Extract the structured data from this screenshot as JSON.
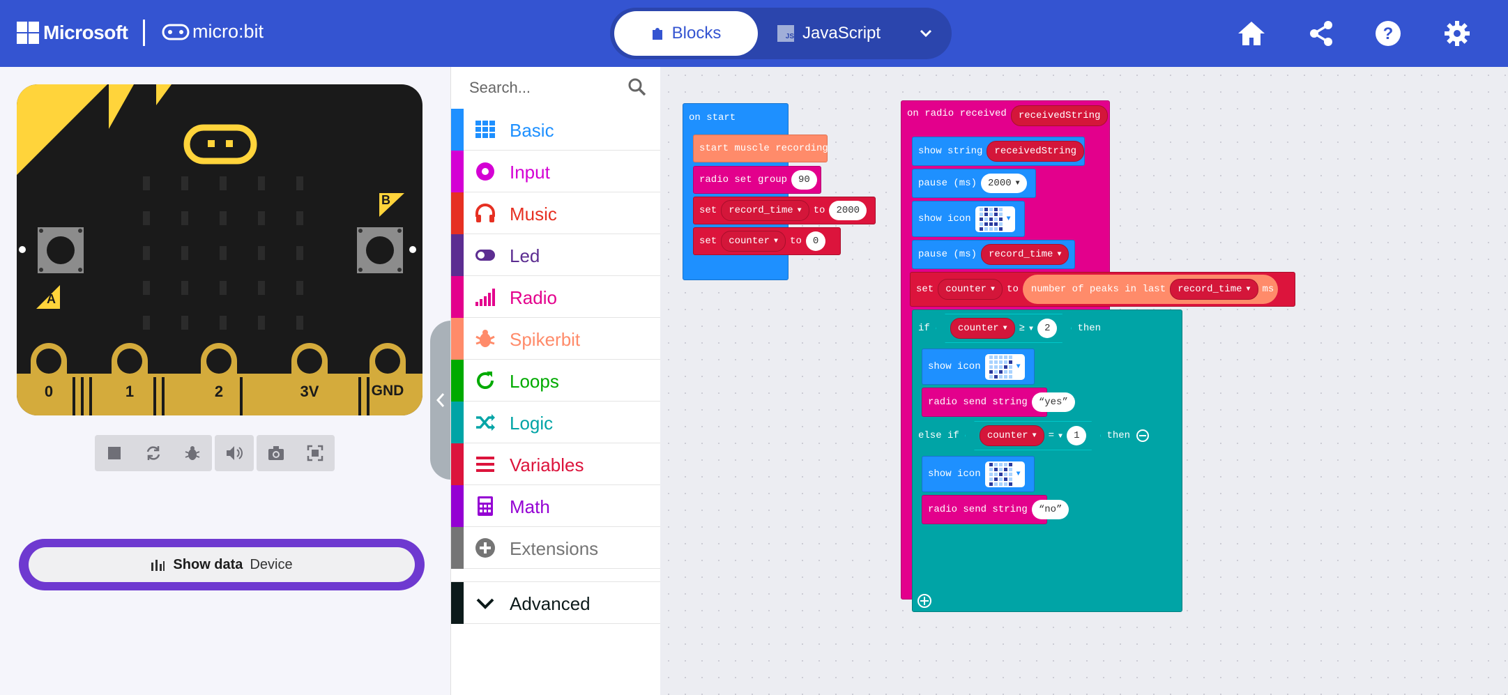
{
  "header": {
    "microsoft_label": "Microsoft",
    "microbit_label": "micro:bit",
    "tabs": [
      {
        "label": "Blocks",
        "active": true
      },
      {
        "label": "JavaScript",
        "active": false
      }
    ],
    "js_badge": "JS",
    "icons": [
      "home-icon",
      "share-icon",
      "help-icon",
      "settings-icon"
    ],
    "color": "#3454d1"
  },
  "simulator": {
    "pin_labels": [
      "0",
      "1",
      "2",
      "3V",
      "GND"
    ],
    "button_a": "A",
    "button_b": "B",
    "toolbar_icons": [
      "stop-icon",
      "restart-icon",
      "debug-icon",
      "mute-icon",
      "screenshot-icon",
      "fullscreen-icon"
    ],
    "show_data": {
      "label": "Show data",
      "sublabel": "Device"
    }
  },
  "toolbox": {
    "search_placeholder": "Search...",
    "categories": [
      {
        "label": "Basic",
        "color": "#1e90ff",
        "icon": "grid-icon"
      },
      {
        "label": "Input",
        "color": "#d400d4",
        "icon": "circle-dot-icon"
      },
      {
        "label": "Music",
        "color": "#e63022",
        "icon": "headphones-icon"
      },
      {
        "label": "Led",
        "color": "#5c2d91",
        "icon": "toggle-icon"
      },
      {
        "label": "Radio",
        "color": "#e3008c",
        "icon": "signal-bars-icon"
      },
      {
        "label": "Spikerbit",
        "color": "#ff8b6a",
        "icon": "bug-icon"
      },
      {
        "label": "Loops",
        "color": "#00aa00",
        "icon": "loop-arrow-icon"
      },
      {
        "label": "Logic",
        "color": "#00a4a6",
        "icon": "shuffle-icon"
      },
      {
        "label": "Variables",
        "color": "#dc143c",
        "icon": "list-lines-icon"
      },
      {
        "label": "Math",
        "color": "#9400d3",
        "icon": "calculator-icon"
      },
      {
        "label": "Extensions",
        "color": "#757575",
        "icon": "plus-circle-icon"
      }
    ],
    "advanced": {
      "label": "Advanced",
      "color": "#0c1a1a",
      "icon": "chevron-down-icon"
    }
  },
  "blocks": {
    "on_start": {
      "hat": "on start",
      "start_recording": "start muscle recording",
      "radio_set_group": "radio set group",
      "group_value": "90",
      "set1_kw": "set",
      "set1_var": "record_time",
      "set1_to": "to",
      "set1_value": "2000",
      "set2_kw": "set",
      "set2_var": "counter",
      "set2_to": "to",
      "set2_value": "0"
    },
    "on_radio": {
      "hat": "on radio received",
      "param": "receivedString",
      "show_string": "show string",
      "show_string_arg": "receivedString",
      "pause1": "pause (ms)",
      "pause1_value": "2000",
      "show_icon1": "show icon",
      "pause2": "pause (ms)",
      "pause2_value": "record_time",
      "set_kw": "set",
      "set_var": "counter",
      "set_to": "to",
      "peaks": "number of peaks in last",
      "peaks_var": "record_time",
      "peaks_unit": "ms",
      "if_kw": "if",
      "if_var": "counter",
      "if_op": "≥",
      "if_value": "2",
      "then1": "then",
      "show_icon2": "show icon",
      "send1": "radio send string",
      "send1_value": "yes",
      "elseif_kw": "else if",
      "elseif_var": "counter",
      "elseif_op": "=",
      "elseif_value": "1",
      "then2": "then",
      "show_icon3": "show icon",
      "send2": "radio send string",
      "send2_value": "no"
    }
  }
}
